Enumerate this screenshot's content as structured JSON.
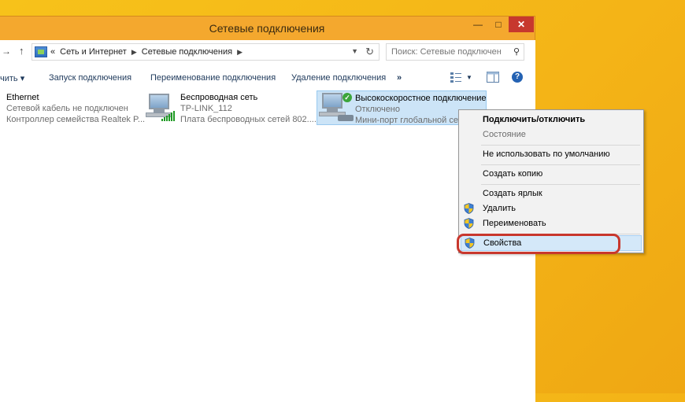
{
  "window": {
    "title": "Сетевые подключения",
    "minimize_glyph": "—",
    "maximize_glyph": "□",
    "close_glyph": "✕"
  },
  "address": {
    "back_glyph": "→",
    "up_glyph": "↑",
    "overflow": "«",
    "crumbs": [
      "Сеть и Интернет",
      "Сетевые подключения"
    ],
    "refresh_glyph": "↻",
    "dropdown_glyph": "▼"
  },
  "search": {
    "placeholder": "Поиск: Сетевые подключения"
  },
  "toolbar": {
    "organize": "чить ▾",
    "launch": "Запуск подключения",
    "rename": "Переименование подключения",
    "delete": "Удаление подключения",
    "more": "»",
    "help": "?"
  },
  "connections": [
    {
      "name": "Ethernet",
      "status": "Сетевой кабель не подключен",
      "device": "Контроллер семейства Realtek P..."
    },
    {
      "name": "Беспроводная сеть",
      "status": "TP-LINK_112",
      "device": "Плата беспроводных сетей 802...."
    },
    {
      "name": "Высокоскоростное подключение",
      "status": "Отключено",
      "device": "Мини-порт глобальной сети"
    }
  ],
  "context_menu": {
    "items": [
      "Подключить/отключить",
      "Состояние",
      "Не использовать по умолчанию",
      "Создать копию",
      "Создать ярлык",
      "Удалить",
      "Переименовать",
      "Свойства"
    ]
  },
  "colors": {
    "desktop": "#f5b818",
    "titlebar": "#f4a82e",
    "close": "#c7382d",
    "selection": "#cce4f7",
    "callout": "#c8372d"
  }
}
